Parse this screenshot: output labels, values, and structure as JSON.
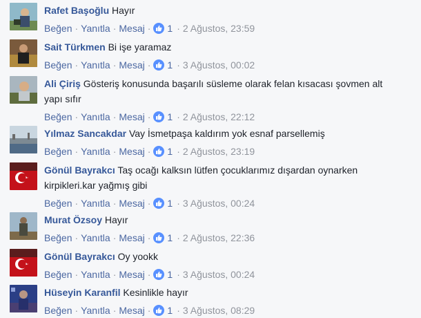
{
  "labels": {
    "like": "Beğen",
    "reply": "Yanıtla",
    "message": "Mesaj",
    "separator": "·"
  },
  "comments": [
    {
      "author": "Rafet Başoğlu",
      "text": "Hayır",
      "text_cont": "",
      "likes": "1",
      "date": "2 Ağustos, 23:59",
      "avatar_icon": "profile-photo"
    },
    {
      "author": "Sait Türkmen",
      "text": "Bi işe yaramaz",
      "text_cont": "",
      "likes": "1",
      "date": "3 Ağustos, 00:02",
      "avatar_icon": "profile-photo"
    },
    {
      "author": "Ali Çiriş",
      "text": "Gösteriş konusunda başarılı süsleme olarak felan kısacası şovmen alt",
      "text_cont": "yapı sıfır",
      "likes": "1",
      "date": "2 Ağustos, 22:12",
      "avatar_icon": "profile-photo"
    },
    {
      "author": "Yılmaz Sancakdar",
      "text": "Vay İsmetpaşa kaldırım yok esnaf parsellemiş",
      "text_cont": "",
      "likes": "1",
      "date": "2 Ağustos, 23:19",
      "avatar_icon": "profile-photo"
    },
    {
      "author": "Gönül Bayrakcı",
      "text": "Taş ocağı kalksın lütfen çocuklarımız dışardan oynarken",
      "text_cont": "kirpikleri.kar yağmış gibi",
      "likes": "1",
      "date": "3 Ağustos, 00:24",
      "avatar_icon": "flag-photo"
    },
    {
      "author": "Murat Özsoy",
      "text": "Hayır",
      "text_cont": "",
      "likes": "1",
      "date": "2 Ağustos, 22:36",
      "avatar_icon": "profile-photo"
    },
    {
      "author": "Gönül Bayrakcı",
      "text": "Oy yookk",
      "text_cont": "",
      "likes": "1",
      "date": "3 Ağustos, 00:24",
      "avatar_icon": "flag-photo"
    },
    {
      "author": "Hüseyin Karanfil",
      "text": "Kesinlikle hayır",
      "text_cont": "",
      "likes": "1",
      "date": "3 Ağustos, 08:29",
      "avatar_icon": "profile-photo"
    }
  ],
  "colors": {
    "author": "#365899",
    "link": "#4b67a1",
    "meta": "#90949c",
    "like_badge": "#5890ff",
    "background": "#f6f7f9"
  }
}
